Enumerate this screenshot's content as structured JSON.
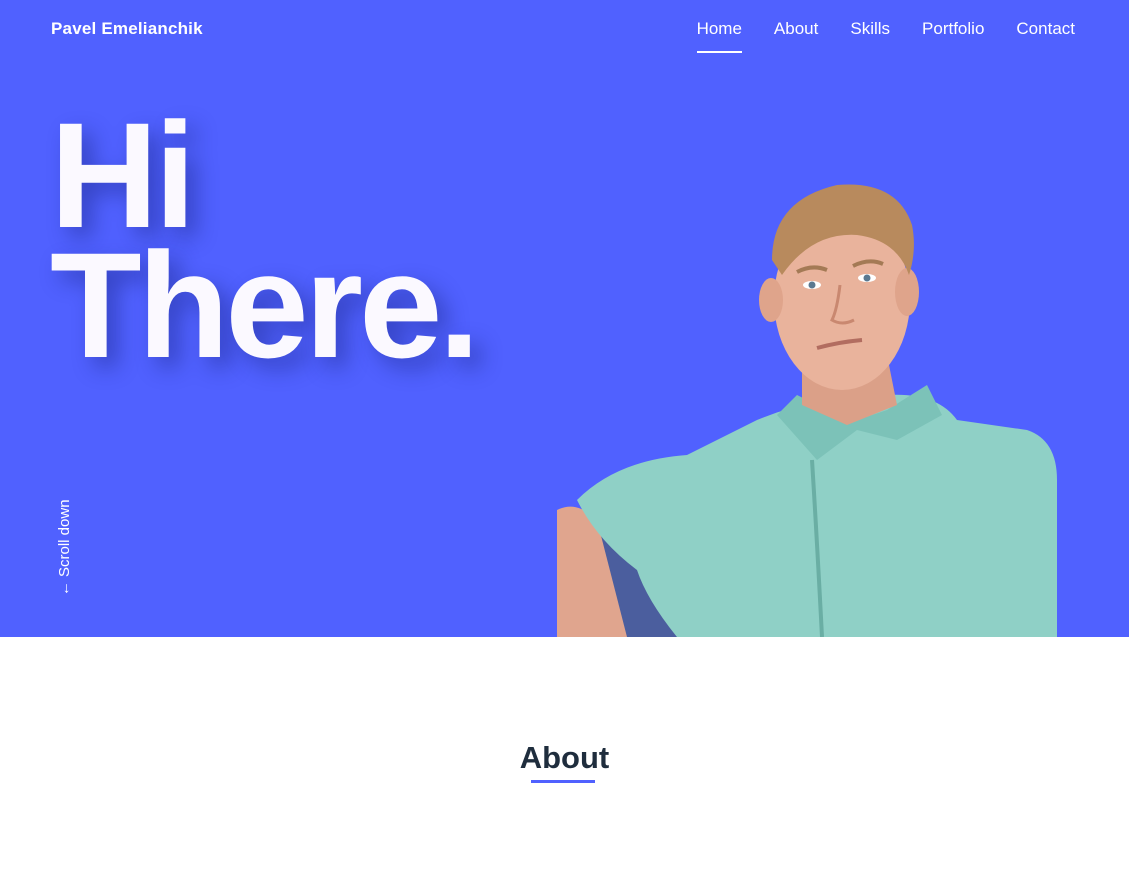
{
  "header": {
    "brand": "Pavel Emelianchik",
    "nav": [
      {
        "label": "Home",
        "active": true
      },
      {
        "label": "About",
        "active": false
      },
      {
        "label": "Skills",
        "active": false
      },
      {
        "label": "Portfolio",
        "active": false
      },
      {
        "label": "Contact",
        "active": false
      }
    ]
  },
  "hero": {
    "line1": "Hi",
    "line2": "There.",
    "scroll_label": "Scroll down",
    "scroll_icon": "arrow-down-icon",
    "photo_icon": "portrait-photo"
  },
  "about": {
    "title": "About"
  },
  "colors": {
    "accent": "#5061ff",
    "text_light": "#ffffff",
    "heading_dark": "#1f2d3d",
    "shirt": "#8fd0c6"
  }
}
